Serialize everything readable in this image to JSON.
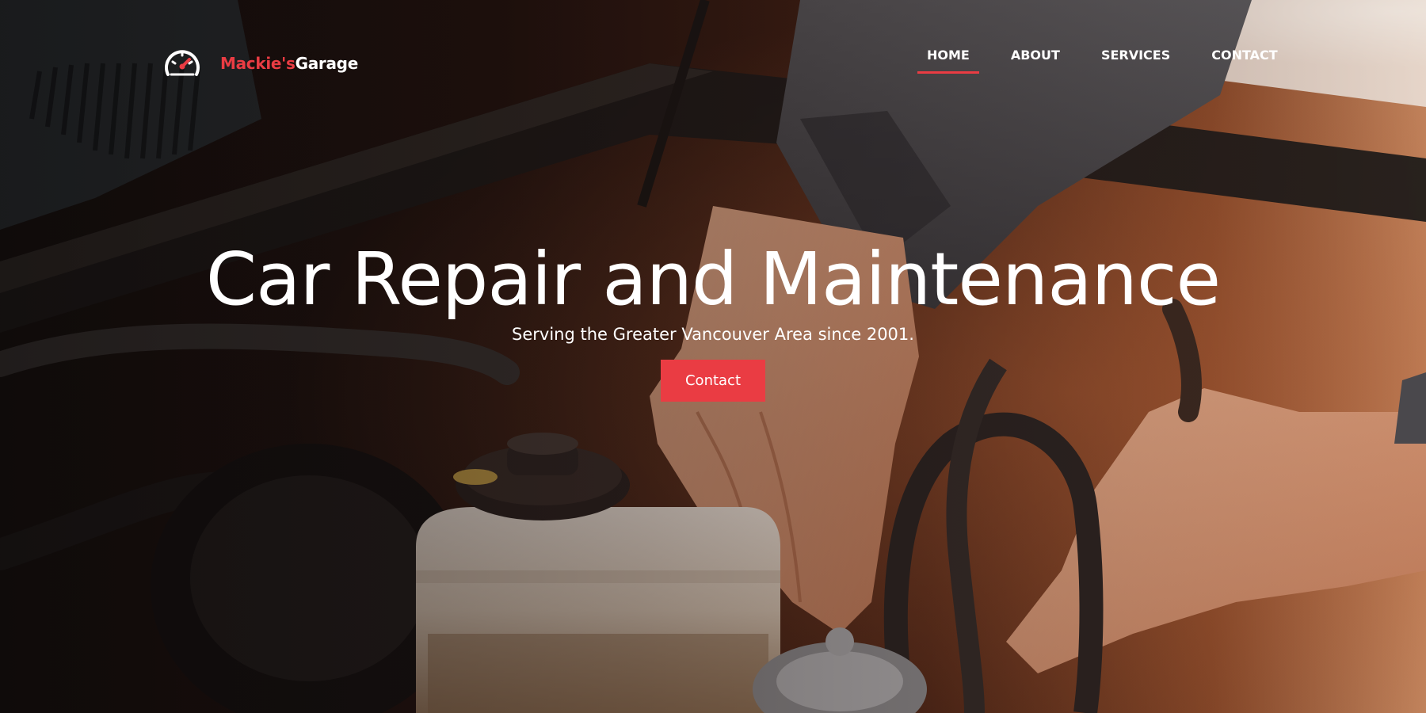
{
  "logo": {
    "icon": "speedometer-icon",
    "name_part1": "Mackie's",
    "name_part2": "Garage"
  },
  "nav": {
    "items": [
      {
        "label": "HOME",
        "active": true
      },
      {
        "label": "ABOUT",
        "active": false
      },
      {
        "label": "SERVICES",
        "active": false
      },
      {
        "label": "CONTACT",
        "active": false
      }
    ]
  },
  "hero": {
    "title": "Car Repair and Maintenance",
    "subtitle": "Serving the Greater Vancouver Area since 2001.",
    "cta_label": "Contact",
    "background": "mechanic-engine-photo"
  },
  "colors": {
    "accent": "#ea3c43",
    "text": "#ffffff"
  }
}
